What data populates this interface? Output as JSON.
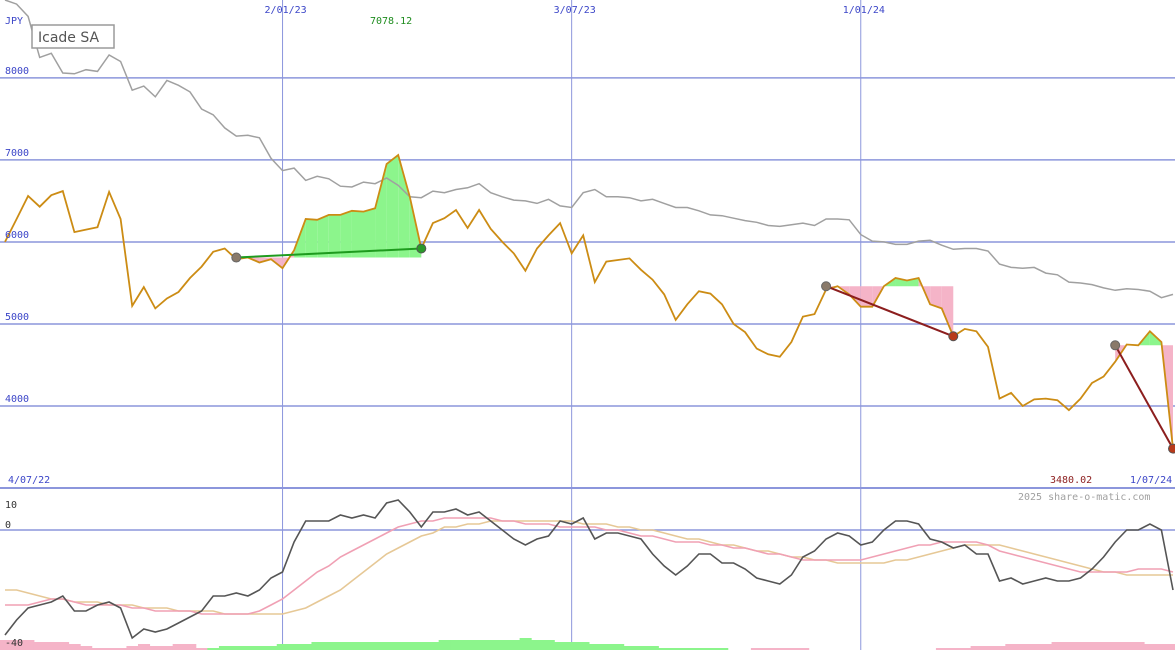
{
  "chart_data": [
    {
      "type": "line",
      "title": "Icade SA",
      "currency": "JPY",
      "x_start_label": "4/07/22",
      "x_end_label": "1/07/24",
      "x_tick_labels": [
        "2/01/23",
        "3/07/23",
        "1/01/24"
      ],
      "y_tick_labels": [
        "8000",
        "7000",
        "6000",
        "5000",
        "4000"
      ],
      "ylim": [
        3000,
        8950
      ],
      "max_label": "7078.12",
      "min_label": "3480.02",
      "copyright": "2025 share-o-matic.com",
      "series": [
        {
          "role": "price",
          "color": "#cc8c14",
          "values": [
            6000,
            6280,
            6560,
            6430,
            6570,
            6620,
            6120,
            6150,
            6180,
            6610,
            6280,
            5220,
            5450,
            5190,
            5310,
            5390,
            5560,
            5700,
            5880,
            5920,
            5790,
            5810,
            5750,
            5790,
            5680,
            5900,
            6280,
            6270,
            6330,
            6330,
            6380,
            6370,
            6410,
            6950,
            7060,
            6550,
            5920,
            6230,
            6290,
            6390,
            6170,
            6390,
            6160,
            6000,
            5860,
            5650,
            5920,
            6080,
            6230,
            5860,
            6080,
            5510,
            5760,
            5780,
            5800,
            5660,
            5540,
            5360,
            5050,
            5240,
            5400,
            5370,
            5240,
            5000,
            4900,
            4700,
            4630,
            4600,
            4780,
            5090,
            5120,
            5420,
            5460,
            5360,
            5210,
            5210,
            5460,
            5560,
            5530,
            5560,
            5240,
            5190,
            4850,
            4940,
            4910,
            4720,
            4090,
            4160,
            4000,
            4080,
            4090,
            4070,
            3950,
            4090,
            4280,
            4360,
            4540,
            4750,
            4740,
            4910,
            4780,
            3480
          ]
        },
        {
          "role": "comparison",
          "color": "#a0a0a0",
          "values": [
            8950,
            8900,
            8750,
            8250,
            8300,
            8060,
            8050,
            8100,
            8080,
            8280,
            8200,
            7850,
            7900,
            7770,
            7970,
            7910,
            7830,
            7620,
            7550,
            7390,
            7290,
            7300,
            7270,
            7020,
            6870,
            6900,
            6750,
            6800,
            6770,
            6680,
            6670,
            6730,
            6710,
            6780,
            6690,
            6550,
            6540,
            6620,
            6600,
            6640,
            6660,
            6710,
            6600,
            6550,
            6510,
            6500,
            6470,
            6520,
            6440,
            6420,
            6600,
            6640,
            6550,
            6550,
            6540,
            6500,
            6520,
            6470,
            6420,
            6420,
            6380,
            6330,
            6320,
            6290,
            6260,
            6240,
            6200,
            6190,
            6210,
            6230,
            6200,
            6280,
            6280,
            6270,
            6090,
            6010,
            6000,
            5970,
            5970,
            6010,
            6020,
            5960,
            5910,
            5920,
            5920,
            5890,
            5730,
            5690,
            5680,
            5690,
            5620,
            5600,
            5510,
            5500,
            5480,
            5440,
            5410,
            5430,
            5420,
            5400,
            5320,
            5360
          ]
        }
      ],
      "trades": [
        {
          "type": "gain",
          "start_index": 20,
          "end_index": 36,
          "start_value": 5810,
          "end_value": 5920
        },
        {
          "type": "loss",
          "start_index": 71,
          "end_index": 82,
          "start_value": 5460,
          "end_value": 4850
        },
        {
          "type": "loss",
          "start_index": 96,
          "end_index": 101,
          "start_value": 4740,
          "end_value": 3480
        }
      ],
      "colors": {
        "grid": "#8c96dc",
        "axis_label": "#3c46c8",
        "gain_fill": "#8cf58c",
        "gain_line": "#1e9b1e",
        "loss_fill": "#f5b4c8",
        "loss_line": "#8c1e1e",
        "max_label": "#1e8c1e",
        "min_label": "#8c1e1e",
        "title_border": "#9a9a9a"
      }
    },
    {
      "type": "line",
      "role": "oscillator",
      "y_tick_labels": [
        "10",
        "0",
        "-40"
      ],
      "ylim": [
        -40,
        10
      ],
      "series": [
        {
          "role": "momentum",
          "color": "#555555",
          "values": [
            -35,
            -30,
            -26,
            -25,
            -24,
            -22,
            -27,
            -27,
            -25,
            -24,
            -26,
            -36,
            -33,
            -34,
            -33,
            -31,
            -29,
            -27,
            -22,
            -22,
            -21,
            -22,
            -20,
            -16,
            -14,
            -4,
            3,
            3,
            3,
            5,
            4,
            5,
            4,
            9,
            10,
            6,
            1,
            6,
            6,
            7,
            5,
            6,
            3,
            0,
            -3,
            -5,
            -3,
            -2,
            3,
            2,
            4,
            -3,
            -1,
            -1,
            -2,
            -3,
            -8,
            -12,
            -15,
            -12,
            -8,
            -8,
            -11,
            -11,
            -13,
            -16,
            -17,
            -18,
            -15,
            -9,
            -7,
            -3,
            -1,
            -2,
            -5,
            -4,
            0,
            3,
            3,
            2,
            -3,
            -4,
            -6,
            -5,
            -8,
            -8,
            -17,
            -16,
            -18,
            -17,
            -16,
            -17,
            -17,
            -16,
            -13,
            -9,
            -4,
            0,
            0,
            2,
            0,
            -20
          ]
        },
        {
          "role": "average-fast",
          "color": "#f0a0b4",
          "values": [
            -25,
            -25,
            -25,
            -24,
            -23,
            -23,
            -24,
            -25,
            -25,
            -25,
            -25,
            -26,
            -26,
            -27,
            -27,
            -27,
            -27,
            -28,
            -28,
            -28,
            -28,
            -28,
            -27,
            -25,
            -23,
            -20,
            -17,
            -14,
            -12,
            -9,
            -7,
            -5,
            -3,
            -1,
            1,
            2,
            3,
            3,
            4,
            4,
            4,
            4,
            4,
            3,
            3,
            2,
            2,
            2,
            1,
            1,
            1,
            1,
            0,
            0,
            -1,
            -2,
            -2,
            -3,
            -4,
            -4,
            -4,
            -5,
            -5,
            -6,
            -6,
            -7,
            -8,
            -8,
            -9,
            -10,
            -10,
            -10,
            -10,
            -10,
            -10,
            -9,
            -8,
            -7,
            -6,
            -5,
            -5,
            -4,
            -4,
            -4,
            -4,
            -5,
            -7,
            -8,
            -9,
            -10,
            -11,
            -12,
            -13,
            -14,
            -14,
            -14,
            -14,
            -14,
            -13,
            -13,
            -13,
            -14
          ]
        },
        {
          "role": "average-slow",
          "color": "#e6c896",
          "values": [
            -20,
            -20,
            -21,
            -22,
            -23,
            -23,
            -24,
            -24,
            -24,
            -25,
            -25,
            -25,
            -26,
            -26,
            -26,
            -27,
            -27,
            -27,
            -27,
            -28,
            -28,
            -28,
            -28,
            -28,
            -28,
            -27,
            -26,
            -24,
            -22,
            -20,
            -17,
            -14,
            -11,
            -8,
            -6,
            -4,
            -2,
            -1,
            1,
            1,
            2,
            2,
            3,
            3,
            3,
            3,
            3,
            3,
            3,
            3,
            2,
            2,
            2,
            1,
            1,
            0,
            0,
            -1,
            -2,
            -3,
            -3,
            -4,
            -5,
            -5,
            -6,
            -7,
            -7,
            -8,
            -9,
            -9,
            -10,
            -10,
            -11,
            -11,
            -11,
            -11,
            -11,
            -10,
            -10,
            -9,
            -8,
            -7,
            -6,
            -5,
            -5,
            -5,
            -5,
            -6,
            -7,
            -8,
            -9,
            -10,
            -11,
            -12,
            -13,
            -14,
            -14,
            -15,
            -15,
            -15,
            -15,
            -15
          ]
        }
      ],
      "histogram": [
        -5,
        -5,
        -5,
        -4,
        -4,
        -4,
        -3,
        -2,
        -1,
        -1,
        -1,
        -2,
        -3,
        -2,
        -2,
        -3,
        -3,
        -1,
        1,
        2,
        2,
        2,
        2,
        2,
        3,
        3,
        3,
        4,
        4,
        4,
        4,
        4,
        4,
        4,
        4,
        4,
        4,
        4,
        5,
        5,
        5,
        5,
        5,
        5,
        5,
        6,
        5,
        5,
        4,
        4,
        4,
        3,
        3,
        3,
        2,
        2,
        2,
        1,
        1,
        1,
        1,
        1,
        1,
        0,
        0,
        -1,
        -1,
        -1,
        -1,
        -1,
        0,
        0,
        0,
        0,
        0,
        0,
        0,
        0,
        0,
        0,
        0,
        -1,
        -1,
        -1,
        -2,
        -2,
        -2,
        -3,
        -3,
        -3,
        -3,
        -4,
        -4,
        -4,
        -4,
        -4,
        -4,
        -4,
        -4,
        -3,
        -3,
        -3
      ]
    }
  ]
}
